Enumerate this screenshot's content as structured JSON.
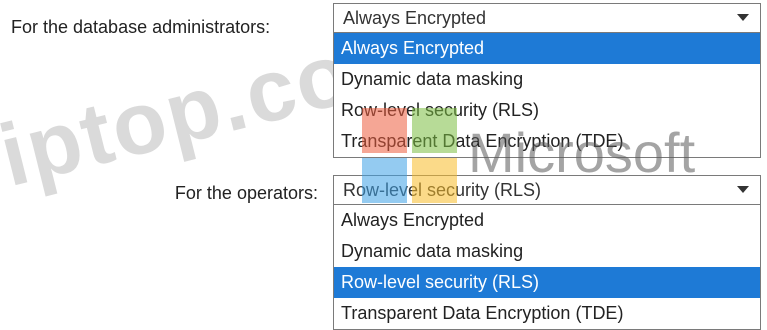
{
  "admins": {
    "label": "For the database administrators:",
    "selected_value": "Always Encrypted",
    "options": [
      {
        "label": "Always Encrypted",
        "selected": true
      },
      {
        "label": "Dynamic data masking",
        "selected": false
      },
      {
        "label": "Row-level security (RLS)",
        "selected": false
      },
      {
        "label": "Transparent Data Encryption (TDE)",
        "selected": false
      }
    ]
  },
  "operators": {
    "label": "For the operators:",
    "selected_value": "Row-level security (RLS)",
    "options": [
      {
        "label": "Always Encrypted",
        "selected": false
      },
      {
        "label": "Dynamic data masking",
        "selected": false
      },
      {
        "label": "Row-level security (RLS)",
        "selected": true
      },
      {
        "label": "Transparent Data Encryption (TDE)",
        "selected": false
      }
    ]
  },
  "watermark": {
    "text": "iptop.com",
    "brand": "Microsoft"
  },
  "colors": {
    "highlight": "#1e7ad6",
    "border": "#7a7a7a"
  },
  "icons": {
    "dropdown_arrow": "chevron-down-icon",
    "logo": "microsoft-logo-icon"
  }
}
